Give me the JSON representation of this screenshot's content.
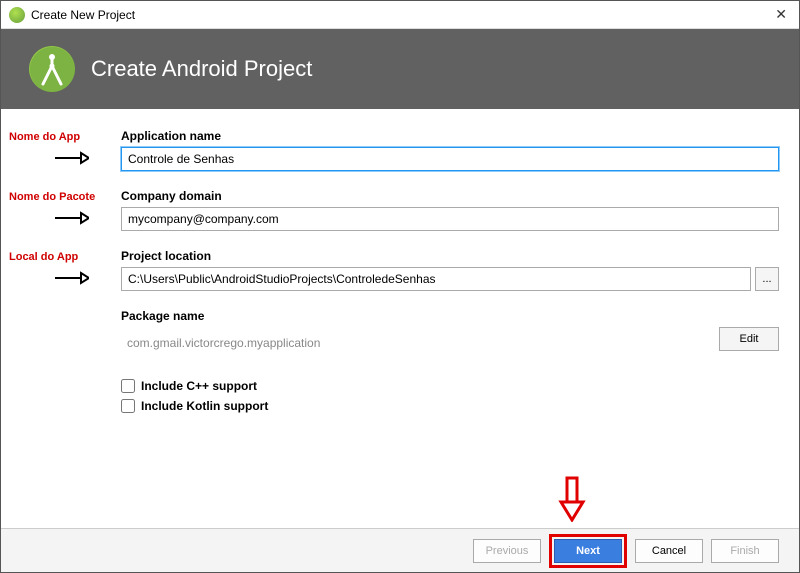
{
  "titlebar": {
    "title": "Create New Project"
  },
  "header": {
    "title": "Create Android Project"
  },
  "annotations": {
    "app_name": "Nome do App",
    "package_name": "Nome do Pacote",
    "app_location": "Local do App"
  },
  "fields": {
    "application_name": {
      "label": "Application name",
      "value": "Controle de Senhas"
    },
    "company_domain": {
      "label": "Company domain",
      "value": "mycompany@company.com"
    },
    "project_location": {
      "label": "Project location",
      "value": "C:\\Users\\Public\\AndroidStudioProjects\\ControledeSenhas",
      "browse_label": "..."
    },
    "package_name": {
      "label": "Package name",
      "value": "com.gmail.victorcrego.myapplication",
      "edit_label": "Edit"
    }
  },
  "checkboxes": {
    "cpp": {
      "label": "Include C++ support",
      "checked": false
    },
    "kotlin": {
      "label": "Include Kotlin support",
      "checked": false
    }
  },
  "footer": {
    "previous": "Previous",
    "next": "Next",
    "cancel": "Cancel",
    "finish": "Finish"
  }
}
